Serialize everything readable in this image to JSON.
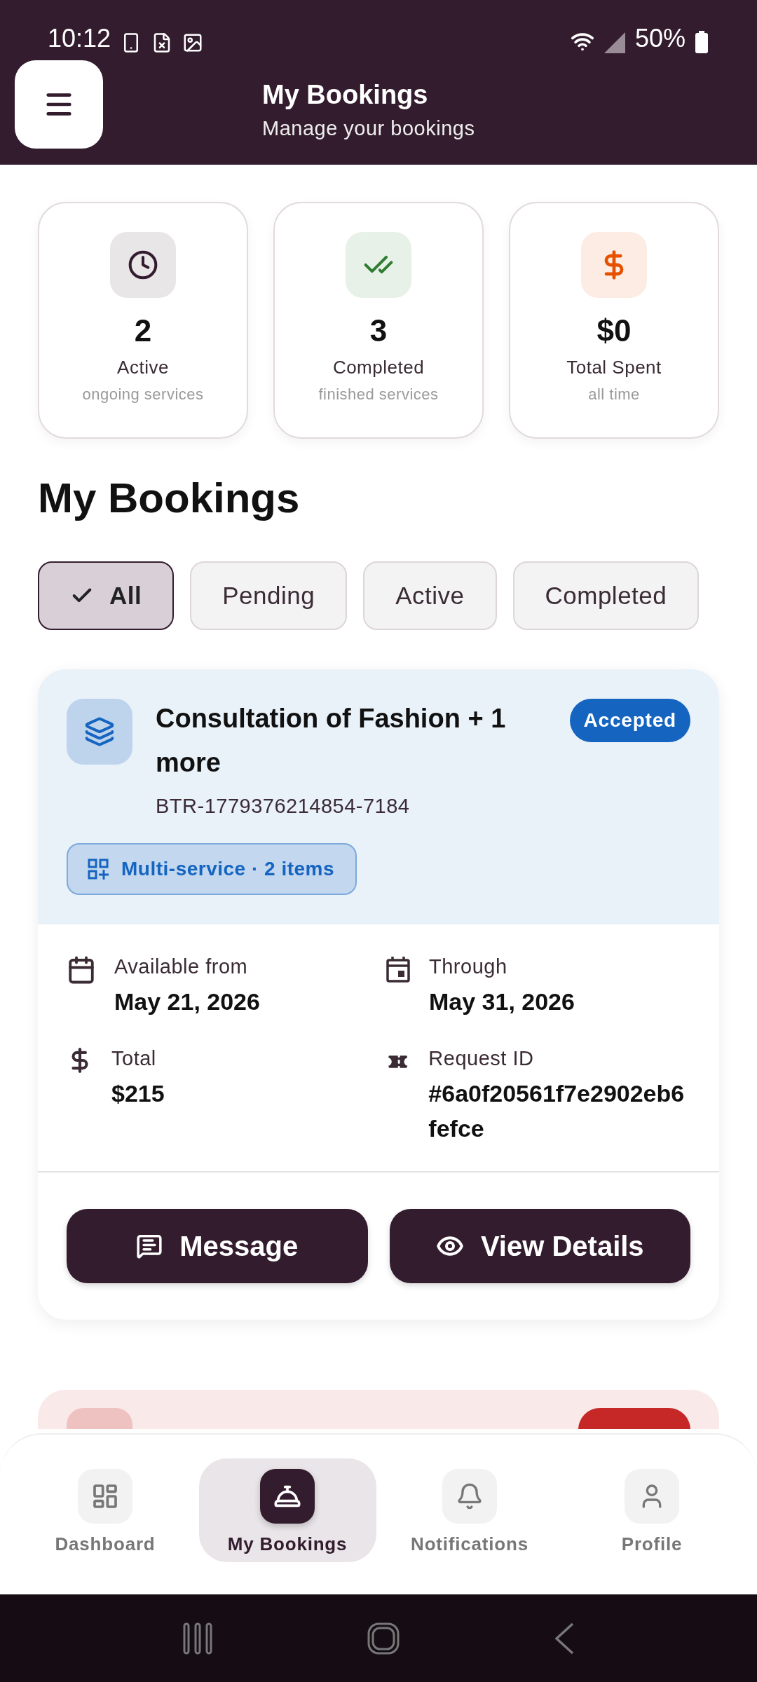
{
  "status_bar": {
    "time": "10:12",
    "battery": "50%"
  },
  "header": {
    "title": "My Bookings",
    "subtitle": "Manage your bookings"
  },
  "stats": [
    {
      "kind": "clock",
      "color": "#331c2e",
      "value": "2",
      "label": "Active",
      "caption": "ongoing services"
    },
    {
      "kind": "check",
      "color": "#2e7d32",
      "value": "3",
      "label": "Completed",
      "caption": "finished services"
    },
    {
      "kind": "dollar",
      "color": "#e65100",
      "value": "$0",
      "label": "Total Spent",
      "caption": "all time"
    }
  ],
  "section_title": "My Bookings",
  "filters": [
    {
      "label": "All",
      "selected": true
    },
    {
      "label": "Pending",
      "selected": false
    },
    {
      "label": "Active",
      "selected": false
    },
    {
      "label": "Completed",
      "selected": false
    }
  ],
  "bookings": [
    {
      "color": "#1565c0",
      "title": "Consultation of Fashion + 1 more",
      "code": "BTR-1779376214854-7184",
      "status": "Accepted",
      "tag": "Multi-service · 2 items",
      "details": [
        {
          "kind": "calendar",
          "label": "Available from",
          "value": "May 21, 2026"
        },
        {
          "kind": "calendar-event",
          "label": "Through",
          "value": "May 31, 2026"
        },
        {
          "kind": "dollar",
          "label": "Total",
          "value": "$215"
        },
        {
          "kind": "ticket",
          "label": "Request ID",
          "value": "#6a0f20561f7e2902eb6fefce"
        }
      ],
      "actions": [
        {
          "kind": "message",
          "label": "Message"
        },
        {
          "kind": "view",
          "label": "View Details"
        }
      ]
    },
    {
      "color": "#c62828"
    }
  ],
  "nav": [
    {
      "kind": "dashboard",
      "label": "Dashboard",
      "selected": false
    },
    {
      "kind": "bookings",
      "label": "My Bookings",
      "selected": true
    },
    {
      "kind": "bell",
      "label": "Notifications",
      "selected": false
    },
    {
      "kind": "profile",
      "label": "Profile",
      "selected": false
    }
  ]
}
